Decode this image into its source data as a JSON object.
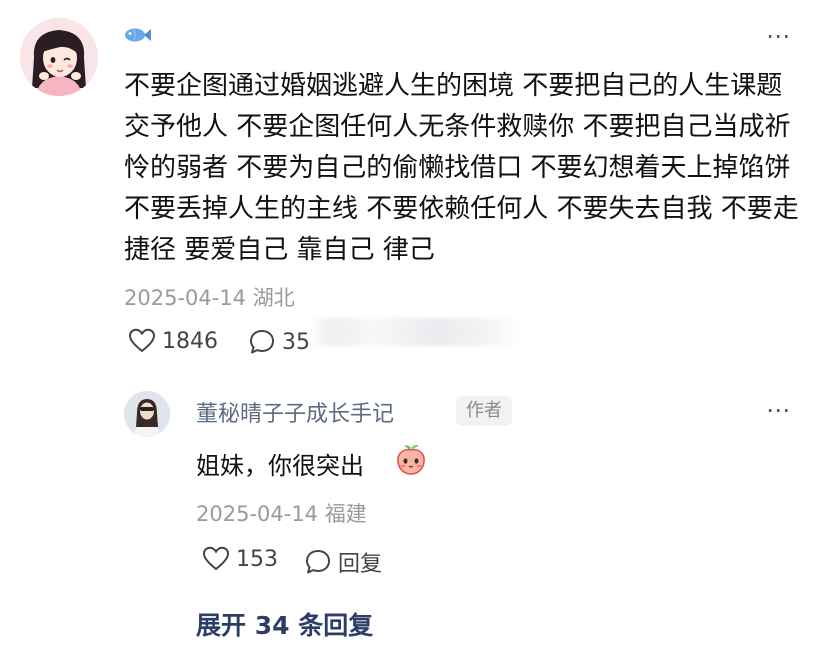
{
  "post": {
    "badge_icon": "fish-icon",
    "more_icon": "more-dots-icon",
    "text": "不要企图通过婚姻逃避人生的困境 不要把自己的人生课题交予他人 不要企图任何人无条件救赎你 不要把自己当成祈怜的弱者 不要为自己的偷懒找借口 不要幻想着天上掉馅饼 不要丢掉人生的主线 不要依赖任何人 不要失去自我 不要走捷径 要爱自己 靠自己 律己",
    "meta": "2025-04-14 湖北",
    "likes": "1846",
    "comments": "35"
  },
  "reply": {
    "author": "董秘晴子子成长手记",
    "author_tag": "作者",
    "text": "姐妹，你很突出",
    "emoji_icon": "peach-emoji-icon",
    "meta": "2025-04-14 福建",
    "likes": "153",
    "reply_label": "回复"
  },
  "expand_label": "展开 34 条回复",
  "colors": {
    "name": "#5b6b80",
    "meta": "#9a9a9a",
    "expand": "#2c3e66"
  }
}
